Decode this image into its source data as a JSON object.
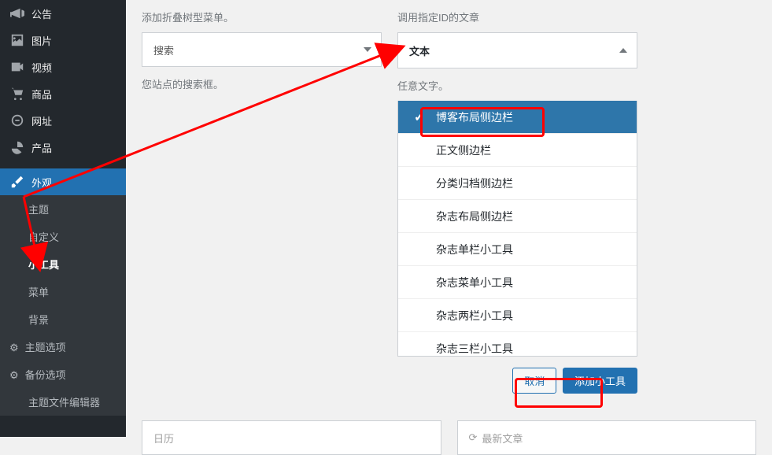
{
  "sidebar": {
    "items": [
      {
        "label": "公告",
        "icon": "megaphone"
      },
      {
        "label": "图片",
        "icon": "image"
      },
      {
        "label": "视频",
        "icon": "video"
      },
      {
        "label": "商品",
        "icon": "cart"
      },
      {
        "label": "网址",
        "icon": "link"
      },
      {
        "label": "产品",
        "icon": "product"
      }
    ],
    "active": {
      "label": "外观",
      "icon": "brush"
    },
    "submenu": [
      {
        "label": "主题"
      },
      {
        "label": "自定义"
      },
      {
        "label": "小工具",
        "current": true
      },
      {
        "label": "菜单"
      },
      {
        "label": "背景"
      },
      {
        "label": "主题选项",
        "icon": "gear"
      },
      {
        "label": "备份选项",
        "icon": "gear"
      },
      {
        "label": "主题文件编辑器"
      }
    ]
  },
  "left": {
    "help1": "添加折叠树型菜单。",
    "dropdown": "搜索",
    "help2": "您站点的搜索框。"
  },
  "right": {
    "help1": "调用指定ID的文章",
    "header": "文本",
    "help2": "任意文字。",
    "areas": [
      "博客布局侧边栏",
      "正文侧边栏",
      "分类归档侧边栏",
      "杂志布局侧边栏",
      "杂志单栏小工具",
      "杂志菜单小工具",
      "杂志两栏小工具",
      "杂志三栏小工具"
    ],
    "cancel": "取消",
    "submit": "添加小工具"
  },
  "bottom": {
    "w1": "日历",
    "w2": "最新文章"
  }
}
